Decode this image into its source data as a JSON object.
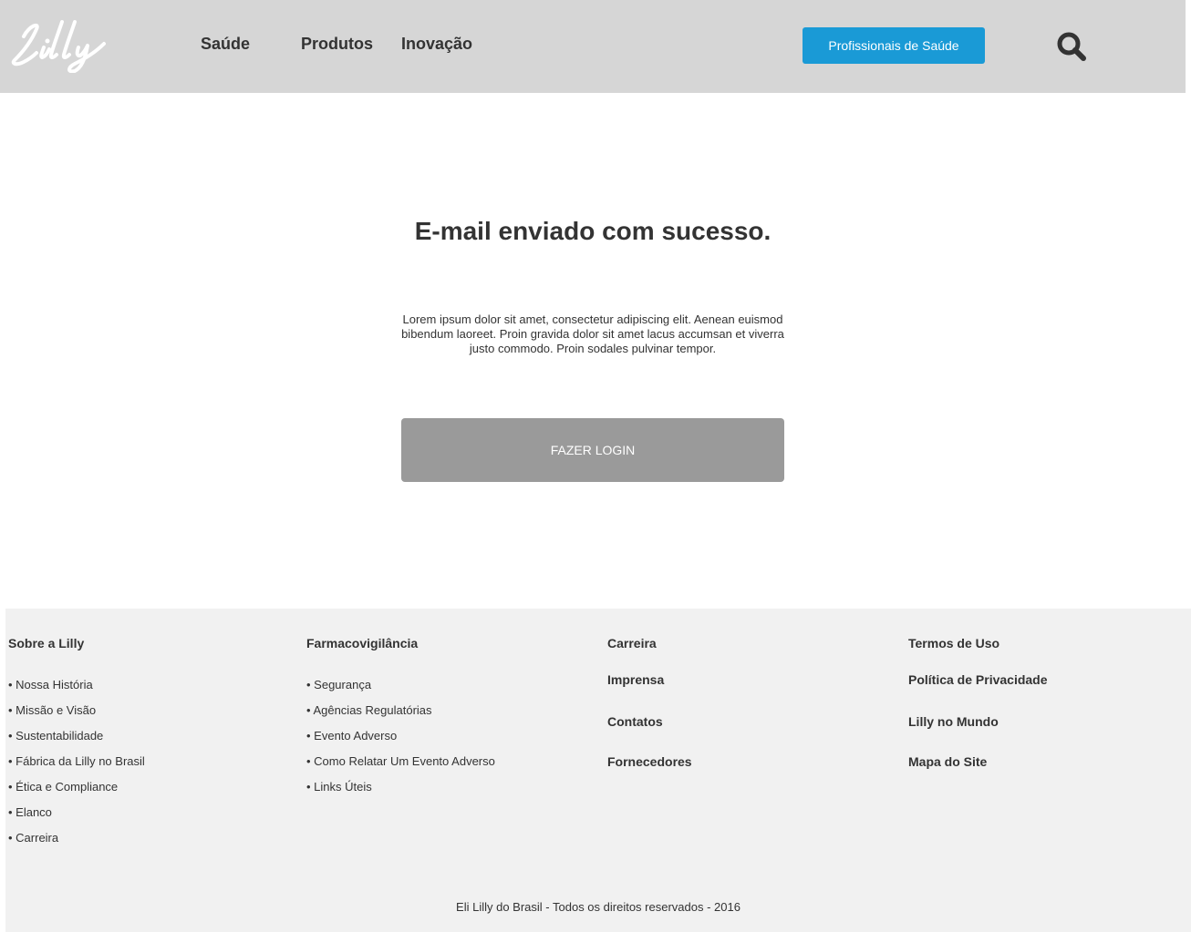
{
  "header": {
    "logo_alt": "Lilly",
    "nav": [
      "Saúde",
      "Produtos",
      "Inovação"
    ],
    "hcp_button": "Profissionais de Saúde",
    "search_icon": "search-icon"
  },
  "main": {
    "title": "E-mail enviado com sucesso.",
    "description": "Lorem ipsum dolor sit amet, consectetur adipiscing elit. Aenean euismod bibendum laoreet. Proin gravida dolor sit amet lacus accumsan et viverra justo commodo. Proin sodales pulvinar tempor.",
    "login_button": "FAZER LOGIN"
  },
  "footer": {
    "col1": {
      "heading": "Sobre a Lilly",
      "links": [
        "• Nossa História",
        "• Missão e Visão",
        "• Sustentabilidade",
        "• Fábrica da Lilly no Brasil",
        "• Ética e Compliance",
        "• Elanco",
        "• Carreira"
      ]
    },
    "col2": {
      "heading": "Farmacovigilância",
      "links": [
        "• Segurança",
        "• Agências Regulatórias",
        "• Evento Adverso",
        "• Como Relatar Um Evento Adverso",
        "• Links Úteis"
      ]
    },
    "col3": {
      "links": [
        "Carreira",
        "Imprensa",
        "Contatos",
        "Fornecedores"
      ]
    },
    "col4": {
      "links": [
        "Termos de Uso",
        "Política de Privacidade",
        "Lilly no Mundo",
        "Mapa do Site"
      ]
    },
    "copyright": "Eli Lilly do Brasil - Todos os direitos reservados - 2016"
  },
  "colors": {
    "header_bg": "#d6d6d6",
    "accent": "#1a9ad6",
    "button_gray": "#9a9a9a",
    "footer_bg": "#f1f1f1",
    "text": "#333333"
  }
}
